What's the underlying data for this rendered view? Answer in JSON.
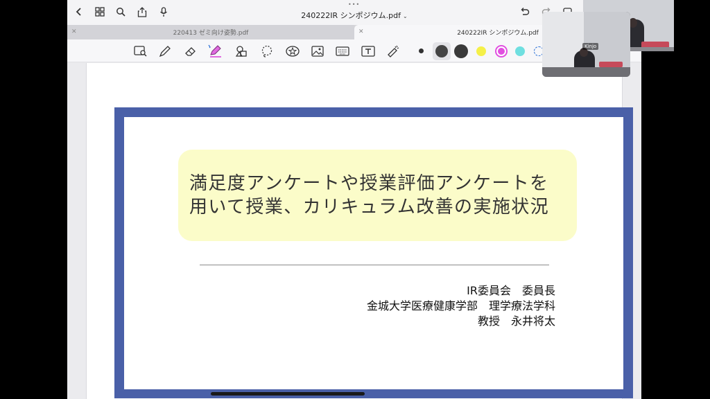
{
  "window": {
    "document_title": "240222IR シンポジウム.pdf"
  },
  "tabs": [
    {
      "label": "220413 ゼミ向け姿勢.pdf",
      "active": false
    },
    {
      "label": "240222IR シンポジウム.pdf",
      "active": true
    }
  ],
  "toolbar": {
    "tools": [
      "zoom-tool",
      "pen-tool",
      "eraser-tool",
      "highlighter-tool",
      "shapes-tool",
      "lasso-tool",
      "sticker-tool",
      "image-tool",
      "keyboard-tool",
      "text-tool",
      "laser-pointer-tool"
    ],
    "swatches": [
      {
        "name": "small-dot",
        "color": "#333333"
      },
      {
        "name": "medium-dot",
        "color": "#444444"
      },
      {
        "name": "large-dot",
        "color": "#3a3a3a"
      },
      {
        "name": "yellow",
        "color": "#f5f048"
      },
      {
        "name": "magenta",
        "color": "#e14fe0"
      },
      {
        "name": "cyan",
        "color": "#6fdfe0"
      }
    ]
  },
  "slide": {
    "title_line1": "満足度アンケートや授業評価アンケートを",
    "title_line2": "用いて授業、カリキュラム改善の実施状況",
    "author_line1": "IR委員会　委員長",
    "author_line2": "金城大学医療健康学部　理学療法学科",
    "author_line3": "教授　永井将太",
    "frame_color": "#4a60a8",
    "title_bg": "#fbfcc9"
  },
  "video": {
    "participant_name": "Kinjo"
  }
}
